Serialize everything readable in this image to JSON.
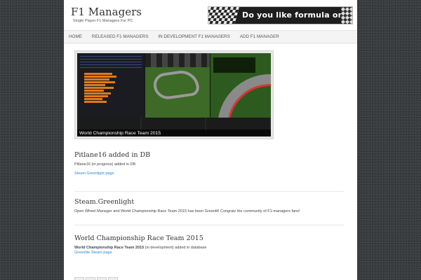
{
  "site": {
    "title": "F1 Managers",
    "tagline": "Single Player F1 Managers For PC",
    "banner_text": "Do you like formula one?"
  },
  "nav": {
    "items": [
      {
        "label": "HOME"
      },
      {
        "label": "RELEASED F1 MANAGERS"
      },
      {
        "label": "IN DEVELOPMENT F1 MANAGERS"
      },
      {
        "label": "ADD F1 MANAGER"
      }
    ]
  },
  "slider": {
    "caption": "World Championship Race Team 2015"
  },
  "posts": [
    {
      "title": "Pitlane16 added in DB",
      "body": "Pitlane16  (in progress)  added in DB",
      "link": "Steam Greenlight page"
    },
    {
      "title": "Steam.Greenlight",
      "body": "Open Wheel Manager and World Championship Race Team 2015 has been Greenlit! Congratz the community of F1-managers fans!"
    },
    {
      "title": "World Championship Race Team 2015",
      "body_bold": "World Championship Race Team 2015",
      "body_rest": " (in development) added in database",
      "link": "Greenlite Steam page"
    }
  ],
  "colors": {
    "link": "#2a8bd0",
    "accent_orange": "#e07a1c"
  }
}
